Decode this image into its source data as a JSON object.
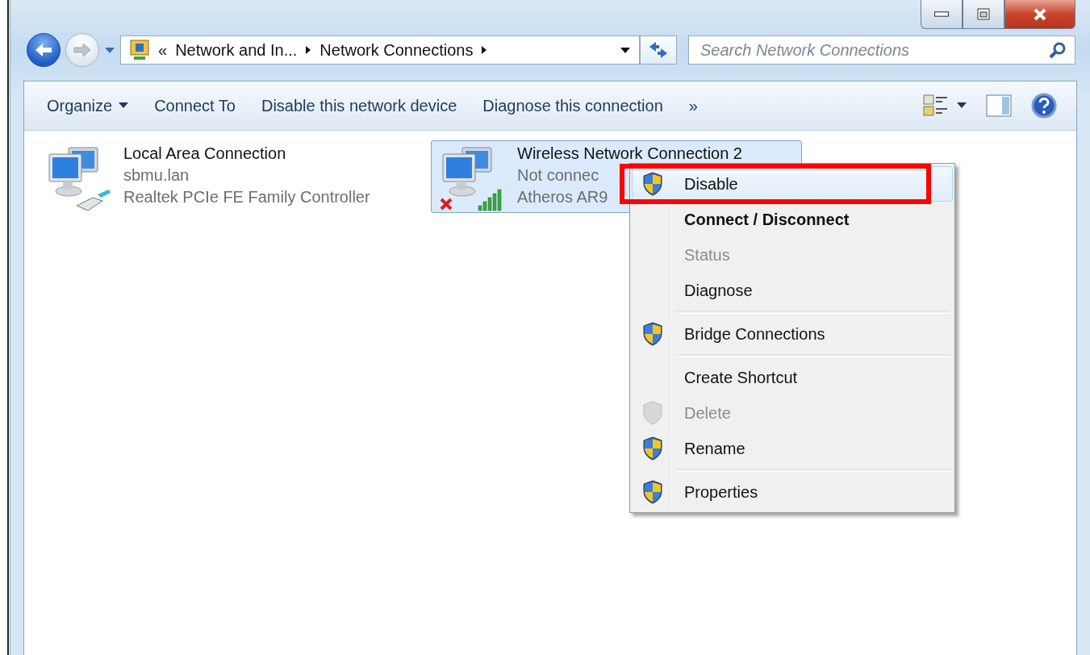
{
  "window": {
    "controls": [
      {
        "kind": "minimize"
      },
      {
        "kind": "maximize"
      },
      {
        "kind": "close"
      }
    ]
  },
  "address_bar": {
    "overflow": "«",
    "crumbs": [
      "Network and In...",
      "Network Connections"
    ]
  },
  "search": {
    "placeholder": "Search Network Connections"
  },
  "toolbar": {
    "items": [
      {
        "label": "Organize",
        "dropdown": true
      },
      {
        "label": "Connect To",
        "dropdown": false
      },
      {
        "label": "Disable this network device",
        "dropdown": false
      },
      {
        "label": "Diagnose this connection",
        "dropdown": false
      }
    ],
    "more": "»"
  },
  "connections": [
    {
      "name": "Local Area Connection",
      "status": "sbmu.lan",
      "device": "Realtek PCIe FE Family Controller",
      "kind": "wired",
      "selected": false
    },
    {
      "name": "Wireless Network Connection 2",
      "status": "Not connec",
      "device": "Atheros AR9",
      "kind": "wireless",
      "selected": true
    }
  ],
  "context_menu": {
    "items": [
      {
        "label": "Disable",
        "shield": true,
        "bold": false,
        "disabled": false,
        "selected": true,
        "annotated": true,
        "separator_before": false
      },
      {
        "label": "Connect / Disconnect",
        "shield": false,
        "bold": true,
        "disabled": false,
        "selected": false,
        "annotated": false,
        "separator_before": false
      },
      {
        "label": "Status",
        "shield": false,
        "bold": false,
        "disabled": true,
        "selected": false,
        "annotated": false,
        "separator_before": false
      },
      {
        "label": "Diagnose",
        "shield": false,
        "bold": false,
        "disabled": false,
        "selected": false,
        "annotated": false,
        "separator_before": false
      },
      {
        "label": "Bridge Connections",
        "shield": true,
        "bold": false,
        "disabled": false,
        "selected": false,
        "annotated": false,
        "separator_before": true
      },
      {
        "label": "Create Shortcut",
        "shield": false,
        "bold": false,
        "disabled": false,
        "selected": false,
        "annotated": false,
        "separator_before": true
      },
      {
        "label": "Delete",
        "shield": true,
        "bold": false,
        "disabled": true,
        "selected": false,
        "annotated": false,
        "separator_before": false
      },
      {
        "label": "Rename",
        "shield": true,
        "bold": false,
        "disabled": false,
        "selected": false,
        "annotated": false,
        "separator_before": false
      },
      {
        "label": "Properties",
        "shield": true,
        "bold": false,
        "disabled": false,
        "selected": false,
        "annotated": false,
        "separator_before": true
      }
    ]
  }
}
